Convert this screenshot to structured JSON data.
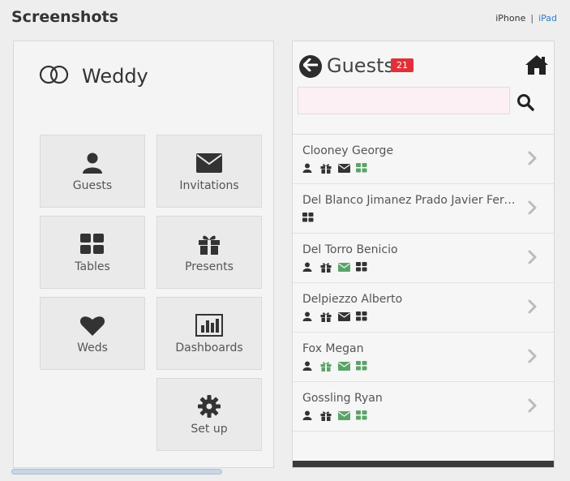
{
  "header": {
    "title": "Screenshots"
  },
  "device_switch": {
    "iphone": "iPhone",
    "separator": "|",
    "ipad": "iPad"
  },
  "app": {
    "brand": "Weddy",
    "tiles": [
      {
        "label": "Guests",
        "icon": "user-icon"
      },
      {
        "label": "Invitations",
        "icon": "envelope-icon"
      },
      {
        "label": "Tables",
        "icon": "grid-icon"
      },
      {
        "label": "Presents",
        "icon": "gift-icon"
      },
      {
        "label": "Weds",
        "icon": "heart-icon"
      },
      {
        "label": "Dashboards",
        "icon": "bar-chart-icon"
      },
      {
        "label": "Set up",
        "icon": "gear-icon"
      }
    ]
  },
  "guests_view": {
    "title": "Guests",
    "count": "21",
    "search_placeholder": "",
    "colors": {
      "active_icon": "#5aa469",
      "inactive_icon": "#333333",
      "badge": "#e0313a"
    },
    "guests": [
      {
        "name": "Clooney George",
        "icons": [
          [
            "user",
            "off"
          ],
          [
            "gift",
            "off"
          ],
          [
            "envelope",
            "off"
          ],
          [
            "table",
            "on"
          ]
        ]
      },
      {
        "name": "Del Blanco Jimanez Prado Javier Fernando",
        "icons": [
          [
            "table",
            "off"
          ]
        ]
      },
      {
        "name": "Del Torro Benicio",
        "icons": [
          [
            "user",
            "off"
          ],
          [
            "gift",
            "off"
          ],
          [
            "envelope",
            "on"
          ],
          [
            "table",
            "off"
          ]
        ]
      },
      {
        "name": "Delpiezzo Alberto",
        "icons": [
          [
            "user",
            "off"
          ],
          [
            "gift",
            "off"
          ],
          [
            "envelope",
            "off"
          ],
          [
            "table",
            "off"
          ]
        ]
      },
      {
        "name": "Fox Megan",
        "icons": [
          [
            "user",
            "off"
          ],
          [
            "gift",
            "on"
          ],
          [
            "envelope",
            "on"
          ],
          [
            "table",
            "on"
          ]
        ]
      },
      {
        "name": "Gossling Ryan",
        "icons": [
          [
            "user",
            "off"
          ],
          [
            "gift",
            "off"
          ],
          [
            "envelope",
            "on"
          ],
          [
            "table",
            "on"
          ]
        ]
      }
    ]
  }
}
